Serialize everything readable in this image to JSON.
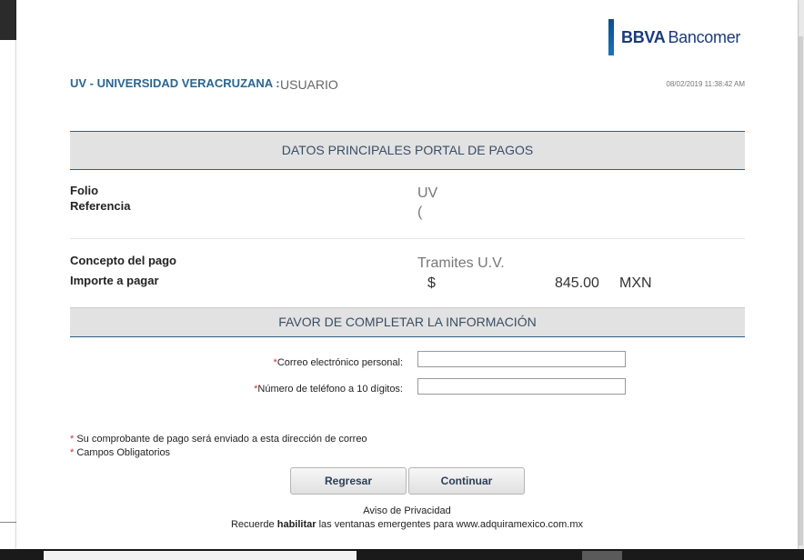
{
  "header": {
    "logo_bold": "BBVA",
    "logo_regular": "Bancomer",
    "org_title": "UV - UNIVERSIDAD VERACRUZANA :",
    "user_label": "USUARIO",
    "timestamp": "08/02/2019 11:38:42 AM"
  },
  "datos": {
    "section_title": "DATOS PRINCIPALES PORTAL DE PAGOS",
    "folio_label": "Folio",
    "folio_value": "UV",
    "referencia_label": "Referencia",
    "referencia_value": "(",
    "concepto_label": "Concepto del pago",
    "concepto_value": "Tramites U.V.",
    "importe_label": "Importe a pagar",
    "importe_currency": "$",
    "importe_amount": "845.00",
    "importe_code": "MXN"
  },
  "form": {
    "section_title": "FAVOR DE COMPLETAR LA INFORMACIÓN",
    "required_mark": "*",
    "email_label": "Correo electrónico personal:",
    "email_value": "",
    "phone_label": "Número de teléfono a 10 dígitos:",
    "phone_value": ""
  },
  "notes": {
    "mark": "*",
    "note1": "Su comprobante de pago será enviado a esta dirección de correo",
    "note2": "Campos Obligatorios"
  },
  "buttons": {
    "back": "Regresar",
    "continue": "Continuar"
  },
  "footer": {
    "privacy": "Aviso de Privacidad",
    "reminder_pre": "Recuerde",
    "reminder_bold": "habilitar",
    "reminder_post": "las ventanas emergentes para www.adquiramexico.com.mx"
  },
  "colors": {
    "accent": "#2b6690",
    "band": "#e2e2e2",
    "required": "#cc3333"
  }
}
